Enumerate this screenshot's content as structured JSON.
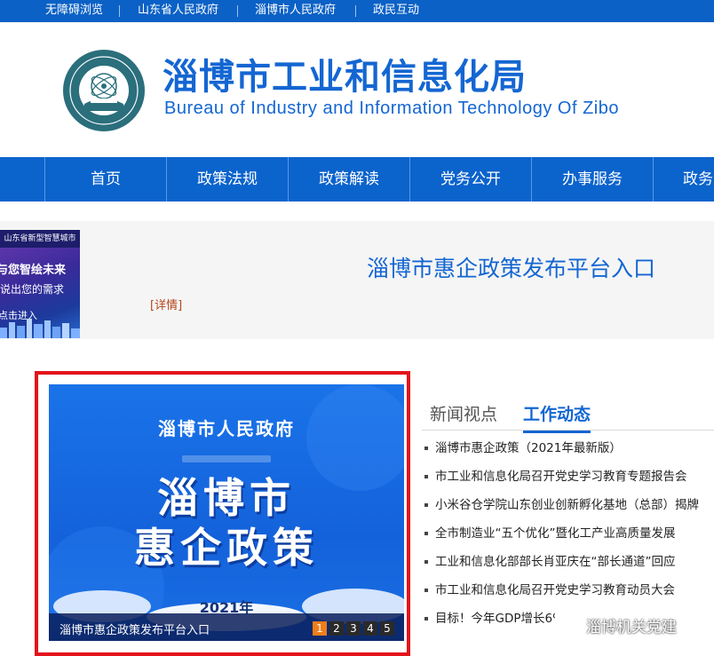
{
  "topbar": {
    "links": [
      "无障碍浏览",
      "山东省人民政府",
      "淄博市人民政府",
      "政民互动"
    ]
  },
  "header": {
    "title": "淄博市工业和信息化局",
    "subtitle": "Bureau of Industry and Information Technology Of Zibo"
  },
  "nav": {
    "items": [
      "首页",
      "政策法规",
      "政策解读",
      "党务公开",
      "办事服务",
      "政务"
    ]
  },
  "banner": {
    "promo": {
      "line1": "山东省新型智慧城市",
      "line2": "与您智绘未来",
      "line3": "说出您的需求",
      "line4": "点击进入"
    },
    "detail_link": "[详情]",
    "platform_link": "淄博市惠企政策发布平台入口"
  },
  "slider": {
    "slide_top": "淄博市人民政府",
    "slide_big1": "淄博市",
    "slide_big2": "惠企政策",
    "slide_year": "2021年",
    "caption": "淄博市惠企政策发布平台入口",
    "pages": [
      "1",
      "2",
      "3",
      "4",
      "5"
    ],
    "active_page": 0
  },
  "tabs": {
    "items": [
      "新闻视点",
      "工作动态"
    ],
    "active": 1
  },
  "news": {
    "items": [
      "淄博市惠企政策（2021年最新版）",
      "市工业和信息化局召开党史学习教育专题报告会",
      "小米谷仓学院山东创业创新孵化基地（总部）揭牌",
      "全市制造业“五个优化”暨化工产业高质量发展",
      "工业和信息化部部长肖亚庆在“部长通道”回应",
      "市工业和信息化局召开党史学习教育动员大会",
      "目标！今年GDP增长6%以上"
    ]
  },
  "watermark": {
    "text": "淄博机关党建"
  },
  "colors": {
    "primary": "#0b63cc",
    "title_blue": "#1466d2",
    "highlight_border": "#e3131b",
    "pager_active": "#f07d1a"
  }
}
